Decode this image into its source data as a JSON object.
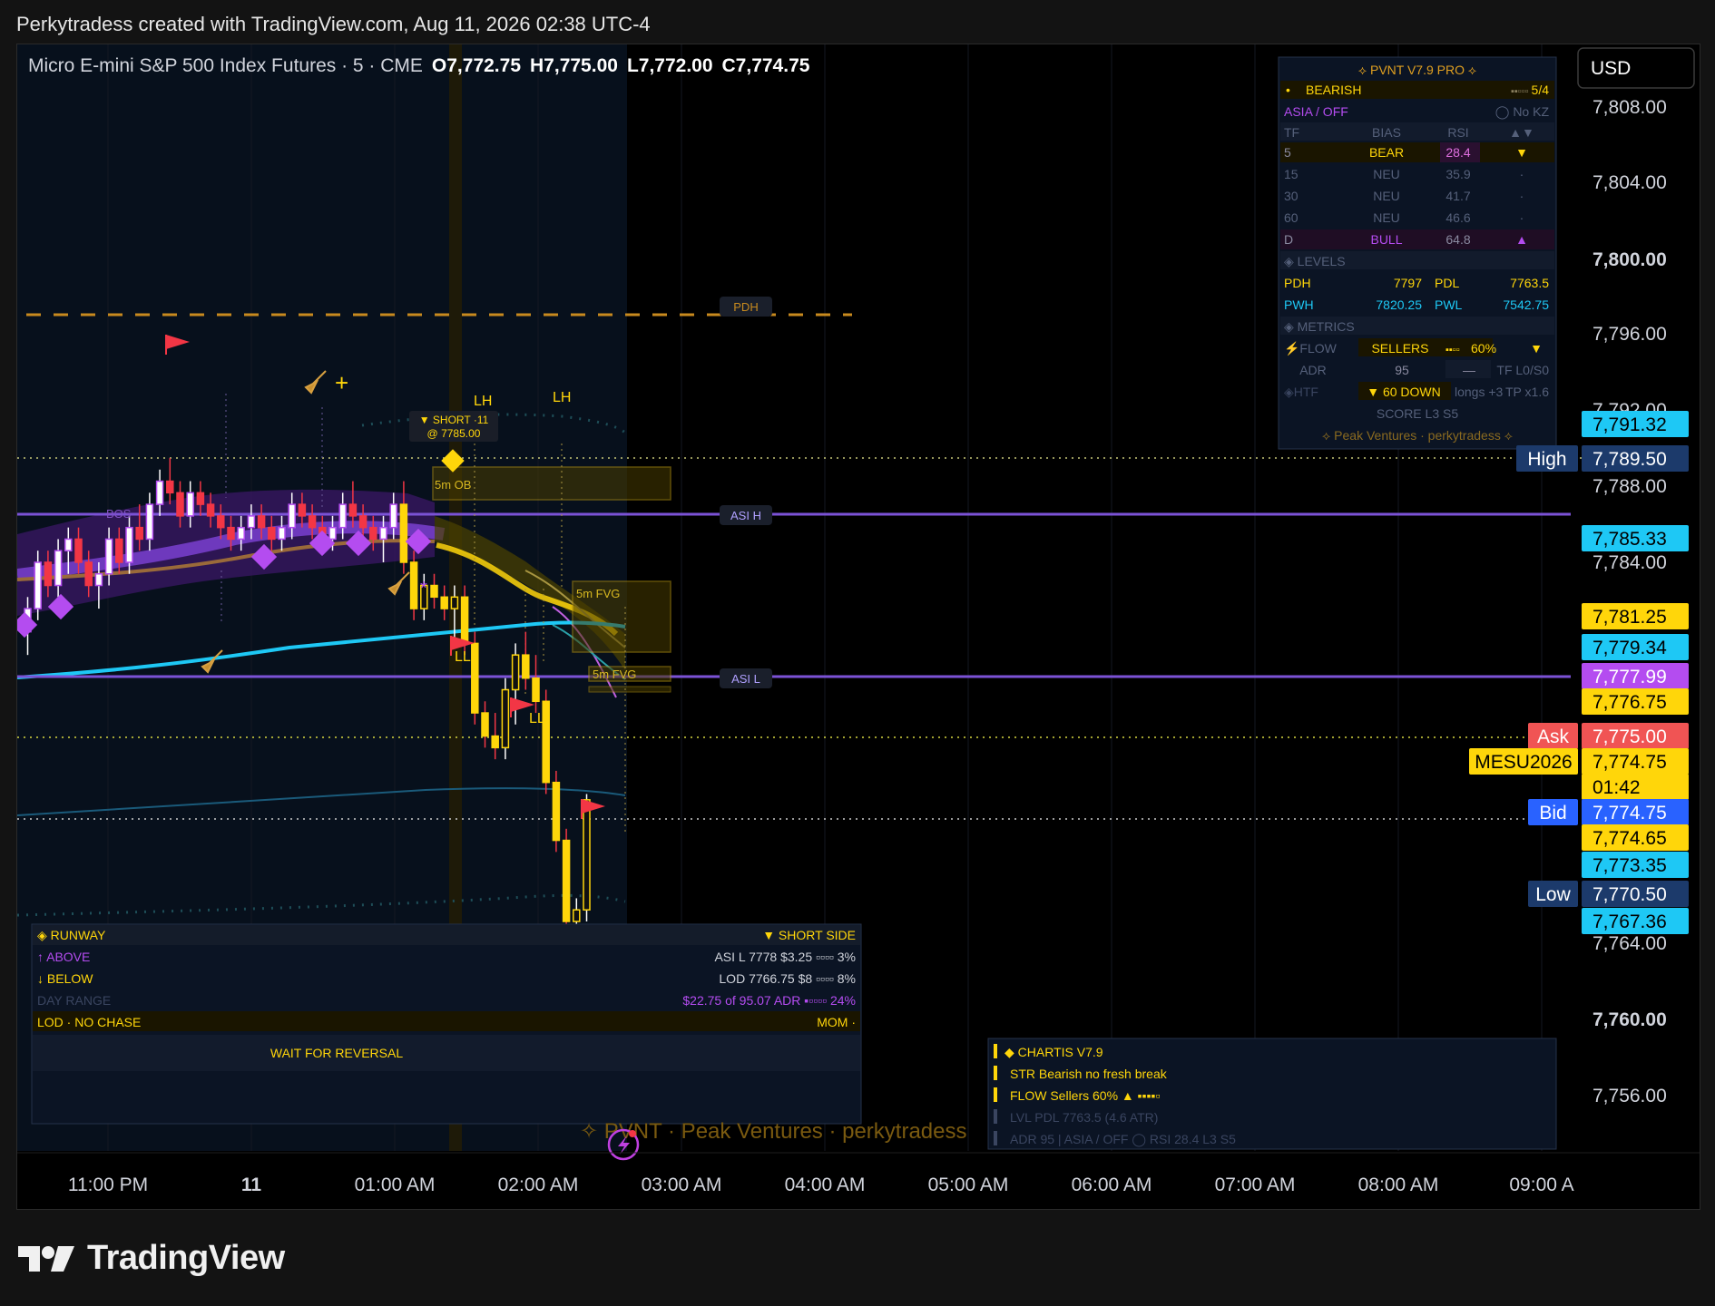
{
  "header": {
    "text": "Perkytradess created with TradingView.com, Aug 11, 2026 02:38 UTC-4"
  },
  "symbol": {
    "name": "Micro E-mini S&P 500 Index Futures · 5 · CME",
    "o": "O7,772.75",
    "h": "H7,775.00",
    "l": "L7,772.00",
    "c": "C7,774.75"
  },
  "currency": "USD",
  "price_axis": {
    "ticks": [
      "7,808.00",
      "7,804.00",
      "7,800.00",
      "7,796.00",
      "7,792.00",
      "7,788.00",
      "7,784.00",
      "7,764.00",
      "7,760.00",
      "7,756.00"
    ],
    "tags": [
      {
        "label": "",
        "value": "7,791.32",
        "color": "#1ec8f5",
        "text": "#000"
      },
      {
        "label": "High",
        "value": "7,789.50",
        "color": "#1c3a6b",
        "text": "#fff"
      },
      {
        "label": "",
        "value": "7,785.33",
        "color": "#1ec8f5",
        "text": "#000"
      },
      {
        "label": "",
        "value": "7,781.25",
        "color": "#ffd60a",
        "text": "#000"
      },
      {
        "label": "",
        "value": "7,779.34",
        "color": "#1ec8f5",
        "text": "#000"
      },
      {
        "label": "",
        "value": "7,777.99",
        "color": "#b44cf0",
        "text": "#fff"
      },
      {
        "label": "",
        "value": "7,776.75",
        "color": "#ffd60a",
        "text": "#000"
      },
      {
        "label": "Ask",
        "value": "7,775.00",
        "color": "#f05454",
        "text": "#fff"
      },
      {
        "label": "MESU2026",
        "value": "7,774.75",
        "color": "#ffd60a",
        "text": "#000"
      },
      {
        "label": "",
        "value": "01:42",
        "color": "#ffd60a",
        "text": "#000"
      },
      {
        "label": "Bid",
        "value": "7,774.75",
        "color": "#2962ff",
        "text": "#fff"
      },
      {
        "label": "",
        "value": "7,774.65",
        "color": "#ffd60a",
        "text": "#000"
      },
      {
        "label": "",
        "value": "7,773.35",
        "color": "#1ec8f5",
        "text": "#000"
      },
      {
        "label": "Low",
        "value": "7,770.50",
        "color": "#1c3a6b",
        "text": "#fff"
      },
      {
        "label": "",
        "value": "7,767.36",
        "color": "#1ec8f5",
        "text": "#000"
      }
    ]
  },
  "time_axis": [
    "11:00 PM",
    "11",
    "01:00 AM",
    "02:00 AM",
    "03:00 AM",
    "04:00 AM",
    "05:00 AM",
    "06:00 AM",
    "07:00 AM",
    "08:00 AM",
    "09:00 A"
  ],
  "labels": {
    "pdh": "PDH",
    "asi_h": "ASI H",
    "asi_l": "ASI L",
    "lh1": "LH",
    "lh2": "LH",
    "ll1": "LL",
    "ll2": "LL",
    "short": "▼ SHORT ·11",
    "short_price": "@ 7785.00",
    "ob": "5m OB",
    "fvg1": "5m FVG",
    "fvg2": "5m FVG",
    "bos": "BOS",
    "plus": "+",
    "star": "*"
  },
  "pvnt": {
    "title": "⟡ PVNT  V7.9  PRO ⟡",
    "bias": "BEARISH",
    "bias_count": "5/4",
    "session": "ASIA / OFF",
    "kz": "◯ No KZ",
    "head": [
      "TF",
      "BIAS",
      "RSI",
      "▲▼"
    ],
    "rows": [
      [
        "5",
        "BEAR",
        "28.4",
        "▼"
      ],
      [
        "15",
        "NEU",
        "35.9",
        "·"
      ],
      [
        "30",
        "NEU",
        "41.7",
        "·"
      ],
      [
        "60",
        "NEU",
        "46.6",
        "·"
      ],
      [
        "D",
        "BULL",
        "64.8",
        "▲"
      ]
    ],
    "levels_title": "◈ LEVELS",
    "pdh": "PDH",
    "pdh_v": "7797",
    "pdl": "PDL",
    "pdl_v": "7763.5",
    "pwh": "PWH",
    "pwh_v": "7820.25",
    "pwl": "PWL",
    "pwl_v": "7542.75",
    "metrics_title": "◈ METRICS",
    "flow": "⚡FLOW",
    "flow_v": "SELLERS",
    "flow_pct": "60%",
    "flow_arrow": "▼",
    "adr": "ADR",
    "adr_v": "95",
    "adr_dash": "—",
    "tf": "TF L0/S0",
    "htf": "◈HTF",
    "htf_v": "▼ 60 DOWN",
    "longs": "longs +3",
    "tp": "TP x1.6",
    "score": "SCORE  L3  S5",
    "footer": "⟡ Peak Ventures  ·  perkytradess ⟡"
  },
  "runway": {
    "title": "◈ RUNWAY",
    "side": "▼ SHORT SIDE",
    "above": "↑ ABOVE",
    "above_v": "ASI L 7778    $3.25   ▫▫▫▫ 3%",
    "below": "↓ BELOW",
    "below_v": "LOD 7766.75    $8    ▫▫▫▫ 8%",
    "day": "DAY RANGE",
    "day_v": "$22.75 of 95.07 ADR  ▪▫▫▫▫ 24%",
    "lod": "LOD · NO CHASE",
    "mom": "MOM ·",
    "wait": "WAIT FOR REVERSAL"
  },
  "chartis": {
    "title": "◆ CHARTIS  V7.9",
    "str": "STR  Bearish  no fresh break",
    "flow": "FLOW Sellers  60% ▲  ▪▪▪▪▫",
    "lvl": "LVL  PDL  7763.5  (4.6 ATR)",
    "adr": "ADR  95  |  ASIA / OFF  ◯  RSI 28.4  L3  S5"
  },
  "watermark": "✧    PVNT   ·   Peak Ventures   ·   perkytradess",
  "footer": {
    "brand": "TradingView"
  },
  "colors": {
    "bull": "#ffffff",
    "bear": "#f23645",
    "short": "#ffd60a",
    "accent_purple": "#b44cf0",
    "vwap": "#1ec8f5"
  },
  "chart_data": {
    "type": "candlestick",
    "ylim": [
      7752,
      7811
    ],
    "candles": [
      [
        7782.0,
        7783.5,
        7781.0,
        7783.0
      ],
      [
        7783.0,
        7785.5,
        7782.5,
        7785.0
      ],
      [
        7785.0,
        7785.5,
        7783.5,
        7784.0
      ],
      [
        7784.0,
        7786.0,
        7783.5,
        7785.5
      ],
      [
        7785.5,
        7786.5,
        7784.5,
        7786.0
      ],
      [
        7786.0,
        7786.5,
        7784.5,
        7785.0
      ],
      [
        7785.0,
        7785.5,
        7783.5,
        7784.0
      ],
      [
        7784.0,
        7785.0,
        7783.0,
        7784.5
      ],
      [
        7784.5,
        7786.5,
        7784.0,
        7786.0
      ],
      [
        7786.0,
        7786.5,
        7784.5,
        7785.0
      ],
      [
        7785.0,
        7787.0,
        7784.5,
        7786.5
      ],
      [
        7786.5,
        7787.5,
        7785.5,
        7786.0
      ],
      [
        7786.0,
        7788.0,
        7785.5,
        7787.5
      ],
      [
        7787.5,
        7789.0,
        7787.0,
        7788.5
      ],
      [
        7788.5,
        7789.5,
        7787.5,
        7788.0
      ],
      [
        7788.0,
        7788.5,
        7786.5,
        7787.0
      ],
      [
        7787.0,
        7788.5,
        7786.5,
        7788.0
      ],
      [
        7788.0,
        7788.5,
        7787.0,
        7787.5
      ],
      [
        7787.5,
        7788.0,
        7786.5,
        7787.0
      ],
      [
        7787.0,
        7787.5,
        7786.0,
        7786.5
      ],
      [
        7786.5,
        7787.0,
        7785.5,
        7786.0
      ],
      [
        7786.0,
        7787.0,
        7785.5,
        7786.5
      ],
      [
        7786.5,
        7787.5,
        7786.0,
        7787.0
      ],
      [
        7787.0,
        7787.5,
        7786.0,
        7786.5
      ],
      [
        7786.5,
        7787.0,
        7785.5,
        7786.0
      ],
      [
        7786.0,
        7787.0,
        7785.5,
        7786.5
      ],
      [
        7786.5,
        7788.0,
        7786.0,
        7787.5
      ],
      [
        7787.5,
        7788.0,
        7786.5,
        7787.0
      ],
      [
        7787.0,
        7787.5,
        7786.0,
        7786.5
      ],
      [
        7786.5,
        7787.0,
        7785.5,
        7786.0
      ],
      [
        7786.0,
        7787.0,
        7785.5,
        7786.5
      ],
      [
        7786.5,
        7788.0,
        7786.0,
        7787.5
      ],
      [
        7787.5,
        7788.5,
        7786.5,
        7787.0
      ],
      [
        7787.0,
        7787.5,
        7786.0,
        7786.5
      ],
      [
        7786.5,
        7787.0,
        7785.5,
        7786.0
      ],
      [
        7786.0,
        7787.0,
        7785.0,
        7786.5
      ],
      [
        7786.5,
        7788.0,
        7786.0,
        7787.5
      ],
      [
        7787.5,
        7788.5,
        7784.5,
        7785.0
      ],
      [
        7785.0,
        7785.5,
        7782.5,
        7783.0
      ],
      [
        7783.0,
        7784.5,
        7782.5,
        7784.0
      ],
      [
        7784.0,
        7784.5,
        7783.0,
        7783.5
      ],
      [
        7783.5,
        7784.0,
        7782.5,
        7783.0
      ],
      [
        7783.0,
        7784.0,
        7781.5,
        7783.5
      ],
      [
        7783.5,
        7784.0,
        7781.0,
        7781.5
      ],
      [
        7781.5,
        7782.0,
        7778.0,
        7778.5
      ],
      [
        7778.5,
        7779.0,
        7777.0,
        7777.5
      ],
      [
        7777.5,
        7778.5,
        7776.5,
        7777.0
      ],
      [
        7777.0,
        7780.0,
        7776.5,
        7779.5
      ],
      [
        7779.5,
        7781.5,
        7778.0,
        7781.0
      ],
      [
        7781.0,
        7782.0,
        7779.5,
        7780.0
      ],
      [
        7780.0,
        7781.0,
        7778.5,
        7779.0
      ],
      [
        7779.0,
        7779.5,
        7775.0,
        7775.5
      ],
      [
        7775.5,
        7776.0,
        7772.5,
        7773.0
      ],
      [
        7773.0,
        7773.5,
        7769.0,
        7769.5
      ],
      [
        7769.5,
        7770.5,
        7767.0,
        7770.0
      ],
      [
        7770.0,
        7775.0,
        7769.5,
        7774.75
      ]
    ]
  }
}
